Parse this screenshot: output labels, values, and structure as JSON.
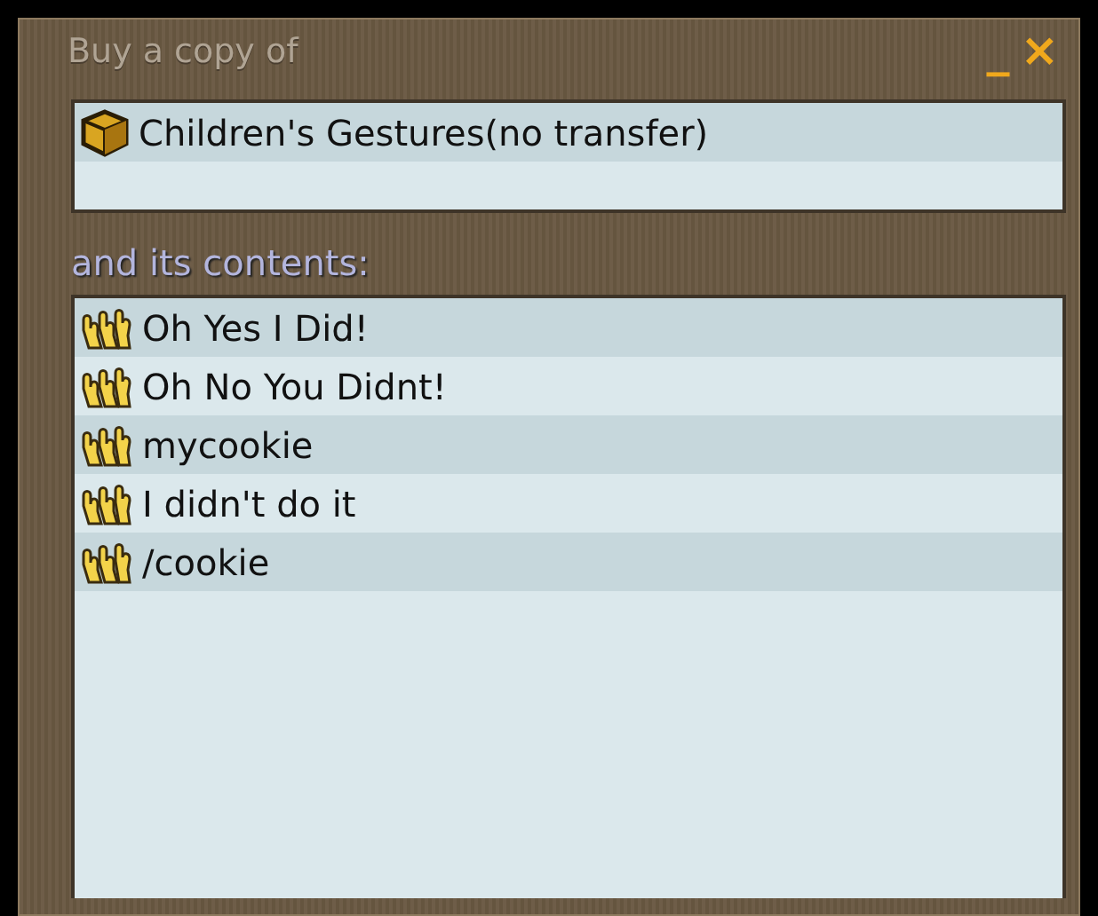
{
  "window": {
    "title": "Buy a copy of",
    "controls": [
      "_",
      "×"
    ]
  },
  "item": {
    "name": "Children's Gestures(no transfer)"
  },
  "contents_label": "and its contents:",
  "contents": [
    {
      "name": "Oh Yes I Did!"
    },
    {
      "name": "Oh No You Didnt!"
    },
    {
      "name": "mycookie"
    },
    {
      "name": "I didn't do it"
    },
    {
      "name": "/cookie"
    }
  ]
}
